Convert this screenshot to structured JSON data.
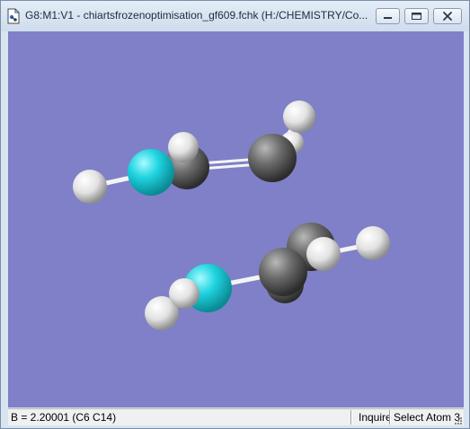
{
  "window": {
    "title": "G8:M1:V1 - chiartsfrozenoptimisation_gf609.fchk (H:/CHEMISTRY/Co...",
    "buttons": [
      "minimize-icon",
      "restore-icon",
      "close-icon"
    ]
  },
  "viewport": {
    "background": "#7f80c8",
    "atom_colors": {
      "carbon": "#6e6e6e",
      "nitrogen": "#1fd4e0",
      "hydrogen": "#e8e8e8"
    }
  },
  "statusbar": {
    "readout": "B = 2.20001 (C6 C14)",
    "mode": "Inquire",
    "action": "Select Atom 3"
  }
}
